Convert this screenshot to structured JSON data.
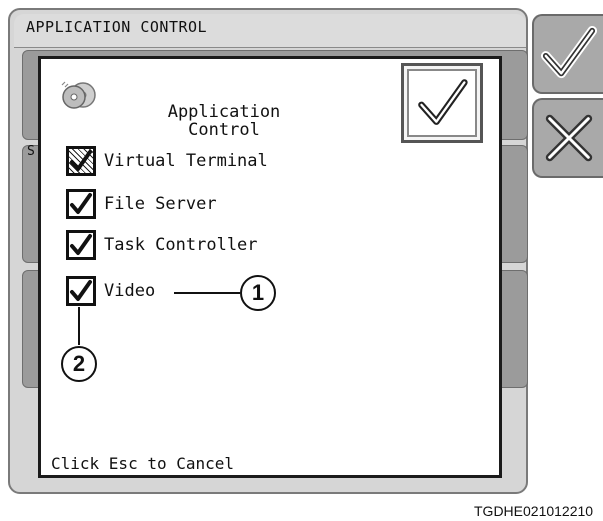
{
  "app": {
    "title": "APPLICATION CONTROL",
    "partial_label": "S"
  },
  "dialog": {
    "title": "Application\nControl",
    "items": [
      {
        "label": "Virtual Terminal",
        "checked": true,
        "state": "disabled-hatched"
      },
      {
        "label": "File Server",
        "checked": true
      },
      {
        "label": "Task Controller",
        "checked": true
      },
      {
        "label": "Video",
        "checked": true
      }
    ],
    "cancel_hint": "Click Esc to Cancel",
    "confirm_icon": "checkmark-icon"
  },
  "side_buttons": [
    {
      "icon": "checkmark-icon"
    },
    {
      "icon": "x-icon"
    }
  ],
  "callouts": [
    "1",
    "2"
  ],
  "reference_code": "TGDHE021012210"
}
